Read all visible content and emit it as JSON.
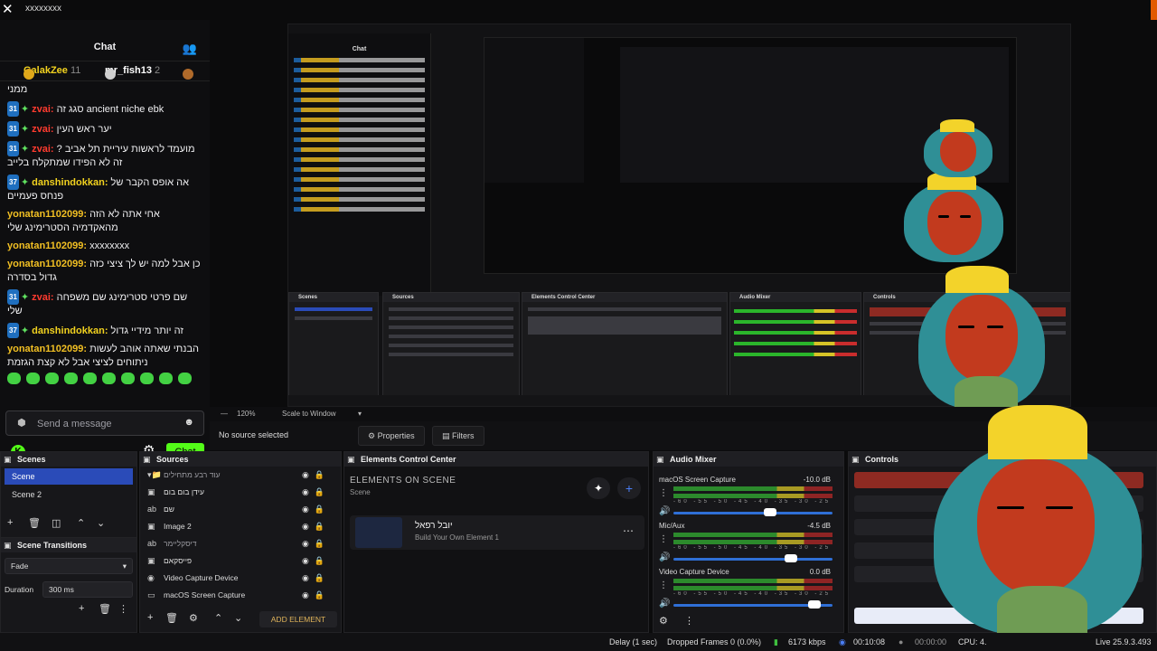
{
  "window": {
    "title": "xxxxxxxx"
  },
  "chat": {
    "title": "Chat",
    "leaders": [
      {
        "name": "GalakZee",
        "count": "11"
      },
      {
        "name": "mr_fish13",
        "count": "2"
      }
    ],
    "first_line": "ממני",
    "messages": [
      {
        "badge": "31",
        "star": true,
        "user": "zvai",
        "cls": "u-zvai",
        "text": "סגג זה ancient niche ebk"
      },
      {
        "badge": "31",
        "star": true,
        "user": "zvai",
        "cls": "u-zvai",
        "text": "יער ראש העין"
      },
      {
        "badge": "31",
        "star": true,
        "user": "zvai",
        "cls": "u-zvai",
        "text": "מועמד לראשות עיריית תל אביב ?זה לא הפידו שמתקלח בלייב"
      },
      {
        "badge": "37",
        "star": true,
        "user": "danshindokkan",
        "cls": "u-dan",
        "text": "אה אופס הקבר של פנחס פעמיים"
      },
      {
        "badge": "",
        "star": false,
        "user": "yonatan1102099",
        "cls": "u-yon",
        "text": "אחי אתה לא הזה מהאקדמיה הסטרימינג שלי"
      },
      {
        "badge": "",
        "star": false,
        "user": "yonatan1102099",
        "cls": "u-yon",
        "text": "xxxxxxxx"
      },
      {
        "badge": "",
        "star": false,
        "user": "yonatan1102099",
        "cls": "u-yon",
        "text": "כן אבל למה יש לך ציצי כזה גדול בסדרה"
      },
      {
        "badge": "31",
        "star": true,
        "user": "zvai",
        "cls": "u-zvai",
        "text": "שם פרטי סטרימינג שם משפחה שלי"
      },
      {
        "badge": "37",
        "star": true,
        "user": "danshindokkan",
        "cls": "u-dan",
        "text": "זה יותר מידיי גדול"
      },
      {
        "badge": "",
        "star": false,
        "user": "yonatan1102099",
        "cls": "u-yon",
        "text": "הבנתי שאתה אוהב לעשות ניתוחים לציצי אבל לא קצת הגזמת"
      }
    ],
    "send_placeholder": "Send a message",
    "chat_button": "Chat"
  },
  "toolbar": {
    "zoom": "120%",
    "scale": "Scale to Window",
    "no_source": "No source selected",
    "properties": "Properties",
    "filters": "Filters"
  },
  "scenes": {
    "title": "Scenes",
    "items": [
      "Scene",
      "Scene 2"
    ]
  },
  "transitions": {
    "title": "Scene Transitions",
    "selected": "Fade",
    "duration_label": "Duration",
    "duration": "300 ms"
  },
  "sources": {
    "title": "Sources",
    "items": [
      {
        "name": "עוד רבע מתחילים",
        "icon": "folder-icon",
        "glyph": "▾📁",
        "dim": true
      },
      {
        "name": "עידן בום בום",
        "icon": "image-icon",
        "glyph": "▣",
        "dim": false
      },
      {
        "name": "שם",
        "icon": "text-icon",
        "glyph": "ab",
        "dim": false
      },
      {
        "name": "Image 2",
        "icon": "image-icon",
        "glyph": "▣",
        "dim": false
      },
      {
        "name": "דיסקליימר",
        "icon": "text-icon",
        "glyph": "ab",
        "dim": true
      },
      {
        "name": "פייסקאם",
        "icon": "image-icon",
        "glyph": "▣",
        "dim": false
      },
      {
        "name": "Video Capture Device",
        "icon": "camera-icon",
        "glyph": "◉",
        "dim": false
      },
      {
        "name": "macOS Screen Capture",
        "icon": "monitor-icon",
        "glyph": "▭",
        "dim": false
      }
    ],
    "add_element": "ADD ELEMENT"
  },
  "elements": {
    "title": "Elements Control Center",
    "heading": "ELEMENTS ON SCENE",
    "sub": "Scene",
    "card_title": "יובל רפאל",
    "card_sub": "Build Your Own Element 1"
  },
  "mixer": {
    "title": "Audio Mixer",
    "scale": "-60 -55 -50 -45 -40 -35 -30 -25 -20 -15 -10 -5 0",
    "channels": [
      {
        "name": "macOS Screen Capture",
        "db": "-10.0 dB",
        "level": 0.62
      },
      {
        "name": "Mic/Aux",
        "db": "-4.5 dB",
        "level": 0.76
      },
      {
        "name": "Video Capture Device",
        "db": "0.0 dB",
        "level": 0.92
      }
    ]
  },
  "controls": {
    "title": "Controls"
  },
  "status": {
    "delay": "Delay (1 sec)",
    "dropped": "Dropped Frames 0 (0.0%)",
    "kbps": "6173 kbps",
    "live_time": "00:10:08",
    "rec_time": "00:00:00",
    "cpu": "CPU: 4.",
    "version": "Live 25.9.3.493"
  },
  "colors": {
    "kick_green": "#53fc18",
    "scene_select": "#2a4bb8",
    "zvai": "#ff3b2f",
    "yonatan": "#f2c023"
  }
}
